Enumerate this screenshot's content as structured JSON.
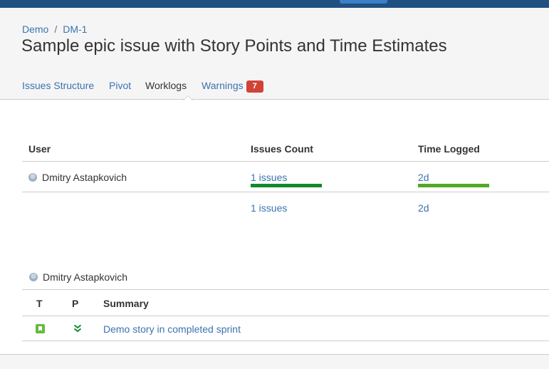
{
  "colors": {
    "topbar": "#205081",
    "link": "#3b73af",
    "badge": "#d04437",
    "issues_bar": "#14892c",
    "time_bar": "#51a825",
    "story": "#63ba3c"
  },
  "breadcrumbs": {
    "project": "Demo",
    "separator": "/",
    "issue_key": "DM-1"
  },
  "page": {
    "title": "Sample epic issue with Story Points and Time Estimates"
  },
  "tabs": [
    {
      "label": "Issues Structure",
      "active": false
    },
    {
      "label": "Pivot",
      "active": false
    },
    {
      "label": "Worklogs",
      "active": true
    },
    {
      "label": "Warnings",
      "active": false,
      "badge": "7"
    }
  ],
  "worklogs": {
    "headers": {
      "user": "User",
      "issues_count": "Issues Count",
      "time_logged": "Time Logged"
    },
    "rows": [
      {
        "user": "Dmitry Astapkovich",
        "avatar_icon": "user-avatar-icon",
        "issues": "1 issues",
        "time": "2d",
        "issues_fraction": 1.0,
        "time_fraction": 1.0
      }
    ],
    "total": {
      "issues": "1 issues",
      "time": "2d"
    }
  },
  "user_section": {
    "user": "Dmitry Astapkovich",
    "headers": {
      "type": "T",
      "priority": "P",
      "summary": "Summary"
    },
    "rows": [
      {
        "type_icon": "story-icon",
        "priority_icon": "priority-lowest-icon",
        "summary": "Demo story in completed sprint"
      }
    ]
  }
}
